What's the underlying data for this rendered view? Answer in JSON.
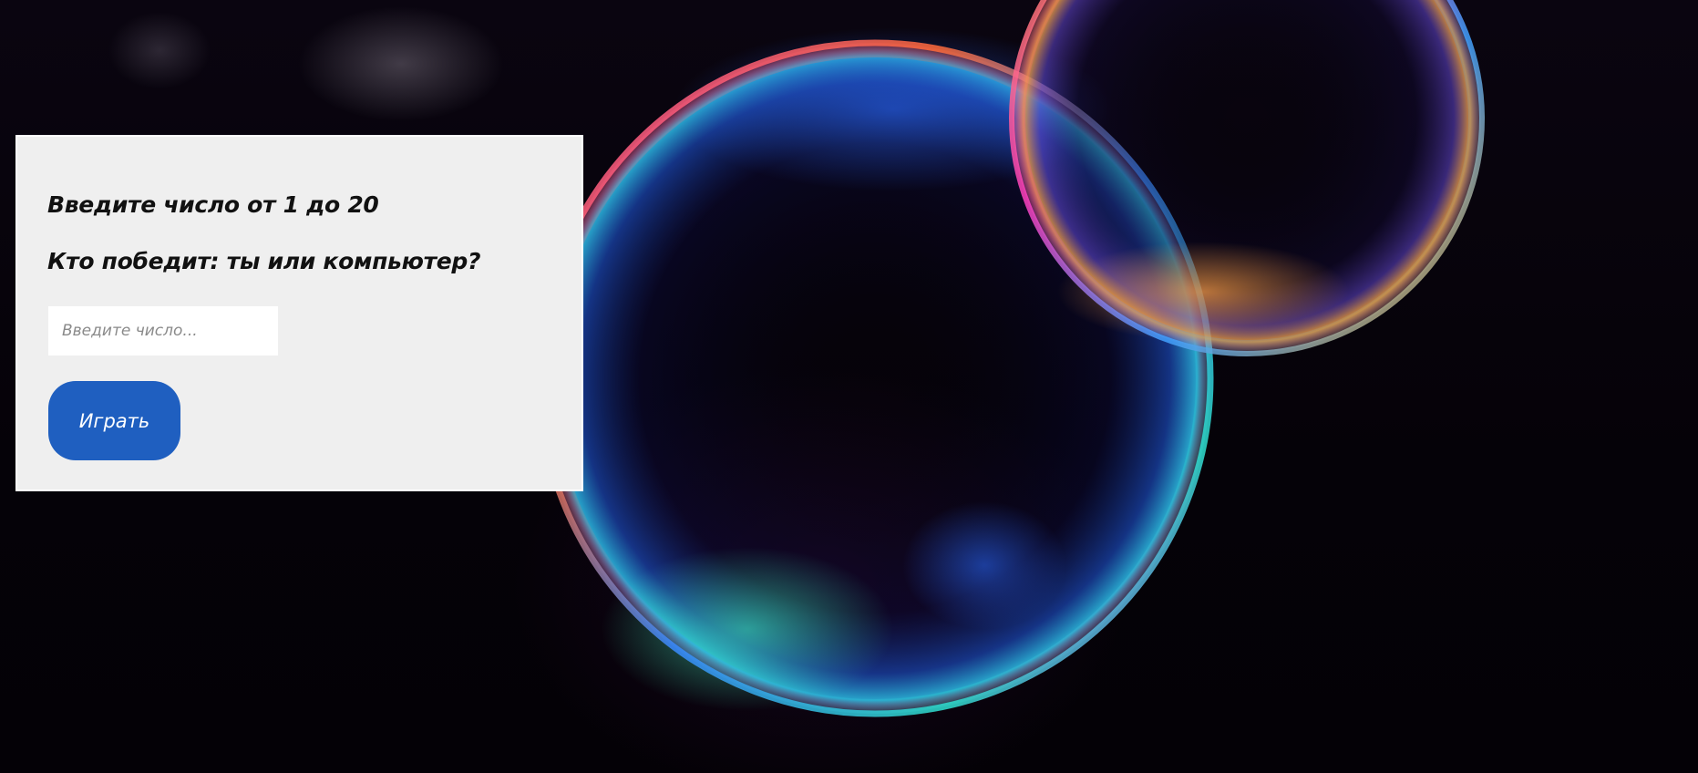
{
  "game": {
    "title_line1": "Введите число от 1 до 20",
    "title_line2": "Кто победит: ты или компьютер?",
    "input_placeholder": "Введите число...",
    "input_value": "",
    "play_button_label": "Играть"
  },
  "colors": {
    "panel_background": "#efefef",
    "button_background": "#1f5fc0",
    "page_background": "#050208"
  }
}
